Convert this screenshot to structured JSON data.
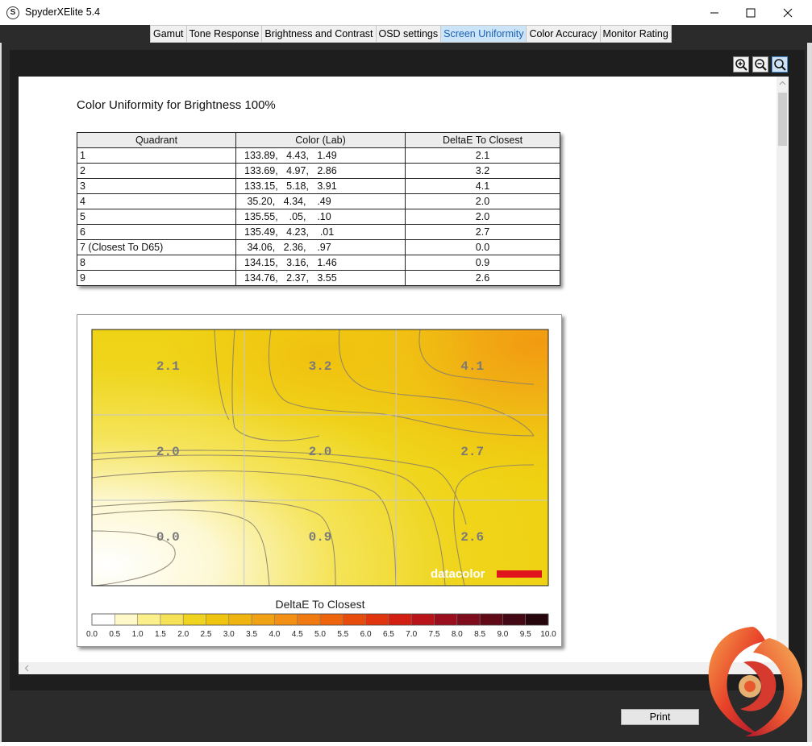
{
  "window": {
    "title": "SpyderXElite 5.4",
    "icon_letter": "S"
  },
  "tabs": [
    {
      "label": "Gamut",
      "active": false
    },
    {
      "label": "Tone Response",
      "active": false
    },
    {
      "label": "Brightness and Contrast",
      "active": false
    },
    {
      "label": "OSD settings",
      "active": false
    },
    {
      "label": "Screen Uniformity",
      "active": true
    },
    {
      "label": "Color Accuracy",
      "active": false
    },
    {
      "label": "Monitor Rating",
      "active": false
    }
  ],
  "toolbar": {
    "icons": [
      "zoom-in-icon",
      "zoom-out-icon",
      "zoom-fit-icon"
    ]
  },
  "report": {
    "title": "Color Uniformity for Brightness 100%",
    "table": {
      "headers": [
        "Quadrant",
        "Color (Lab)",
        "DeltaE To Closest"
      ],
      "rows": [
        [
          "1",
          "133.89,   4.43,   1.49",
          "2.1"
        ],
        [
          "2",
          "133.69,   4.97,   2.86",
          "3.2"
        ],
        [
          "3",
          "133.15,   5.18,   3.91",
          "4.1"
        ],
        [
          "4",
          " 35.20,   4.34,    .49",
          "2.0"
        ],
        [
          "5",
          "135.55,    .05,    .10",
          "2.0"
        ],
        [
          "6",
          "135.49,   4.23,    .01",
          "2.7"
        ],
        [
          "7 (Closest To D65)",
          " 34.06,   2.36,    .97",
          "0.0"
        ],
        [
          "8",
          "134.15,   3.16,   1.46",
          "0.9"
        ],
        [
          "9",
          "134.76,   2.37,   3.55",
          "2.6"
        ]
      ]
    }
  },
  "chart_data": {
    "type": "heatmap",
    "grid": {
      "rows": 3,
      "cols": 3
    },
    "cells": [
      [
        2.1,
        3.2,
        4.1
      ],
      [
        2.0,
        2.0,
        2.7
      ],
      [
        0.0,
        0.9,
        2.6
      ]
    ],
    "cell_labels": [
      [
        "2.1",
        "3.2",
        "4.1"
      ],
      [
        "2.0",
        "2.0",
        "2.7"
      ],
      [
        "0.0",
        "0.9",
        "2.6"
      ]
    ],
    "colorbar": {
      "title": "DeltaE To Closest",
      "min": 0.0,
      "max": 10.0,
      "ticks": [
        "0.0",
        "0.5",
        "1.0",
        "1.5",
        "2.0",
        "2.5",
        "3.0",
        "3.5",
        "4.0",
        "4.5",
        "5.0",
        "5.5",
        "6.0",
        "6.5",
        "7.0",
        "7.5",
        "8.0",
        "8.5",
        "9.0",
        "9.5",
        "10.0"
      ],
      "colors": [
        "#ffffff",
        "#fff8c8",
        "#fbf08c",
        "#f5e256",
        "#efd31e",
        "#efc40e",
        "#f0b410",
        "#f1a214",
        "#f28f14",
        "#f07a10",
        "#ee640d",
        "#e84c0c",
        "#e0340e",
        "#d21f12",
        "#b8141a",
        "#9a0e1e",
        "#7e0c1c",
        "#600a18",
        "#430814",
        "#26060c"
      ]
    },
    "watermark": "datacolor",
    "grid_lines": true
  },
  "footer": {
    "print_label": "Print"
  }
}
